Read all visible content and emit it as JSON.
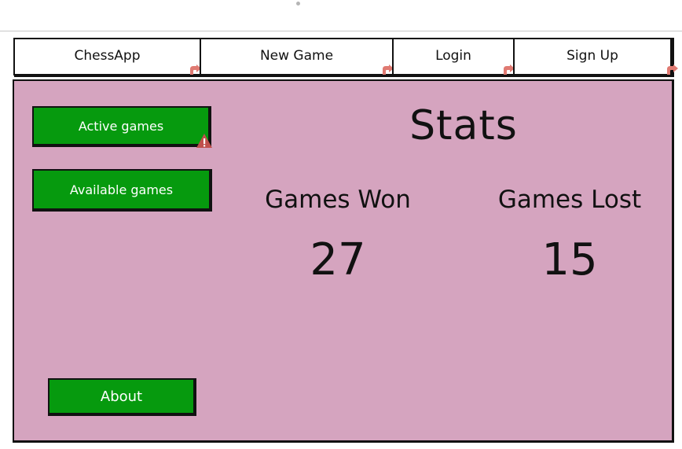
{
  "nav": {
    "tabs": [
      {
        "label": "ChessApp"
      },
      {
        "label": "New Game"
      },
      {
        "label": "Login"
      },
      {
        "label": "Sign Up"
      }
    ]
  },
  "sidebar": {
    "active_games": "Active games",
    "available_games": "Available games",
    "about": "About"
  },
  "stats": {
    "title": "Stats",
    "won_label": "Games Won",
    "won_value": "27",
    "lost_label": "Games Lost",
    "lost_value": "15"
  },
  "colors": {
    "panel_bg": "#d5a4bf",
    "button_green": "#069a0e",
    "link_marker": "#e07a72",
    "warning": "#c0504d"
  },
  "icons": {
    "link_marker": "link-arrow-icon",
    "warning": "warning-icon"
  }
}
